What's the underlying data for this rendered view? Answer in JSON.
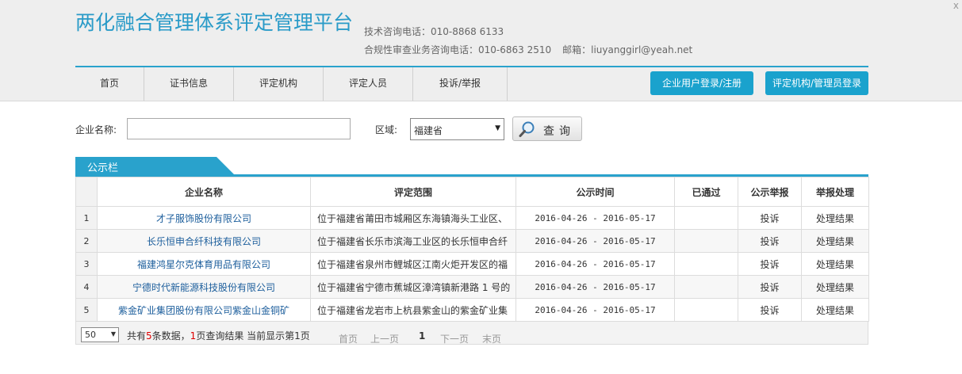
{
  "header": {
    "site_title": "两化融合管理体系评定管理平台",
    "tech_phone": "技术咨询电话：010-8868 6133",
    "compliance_phone": "合规性审查业务咨询电话：010-6863 2510",
    "email": "邮箱：liuyanggirl@yeah.net",
    "corner": "x"
  },
  "nav": {
    "items": [
      {
        "label": "首页"
      },
      {
        "label": "证书信息"
      },
      {
        "label": "评定机构"
      },
      {
        "label": "评定人员"
      },
      {
        "label": "投诉/举报"
      }
    ],
    "enterprise_login": "企业用户登录/注册",
    "admin_login": "评定机构/管理员登录"
  },
  "search": {
    "company_label": "企业名称:",
    "company_value": "",
    "region_label": "区域:",
    "region_value": "福建省",
    "query_button": "查询"
  },
  "panel": {
    "title": "公示栏"
  },
  "table": {
    "headers": [
      "企业名称",
      "评定范围",
      "公示时间",
      "已通过",
      "公示举报",
      "举报处理"
    ],
    "rows": [
      {
        "idx": "1",
        "name": "才子服饰股份有限公司",
        "scope": "位于福建省莆田市城厢区东海镇海头工业区、",
        "time": "2016-04-26 - 2016-05-17",
        "passed": "",
        "report": "投诉",
        "handle": "处理结果"
      },
      {
        "idx": "2",
        "name": "长乐恒申合纤科技有限公司",
        "scope": "位于福建省长乐市滨海工业区的长乐恒申合纤",
        "time": "2016-04-26 - 2016-05-17",
        "passed": "",
        "report": "投诉",
        "handle": "处理结果"
      },
      {
        "idx": "3",
        "name": "福建鸿星尔克体育用品有限公司",
        "scope": "位于福建省泉州市鲤城区江南火炬开发区的福",
        "time": "2016-04-26 - 2016-05-17",
        "passed": "",
        "report": "投诉",
        "handle": "处理结果"
      },
      {
        "idx": "4",
        "name": "宁德时代新能源科技股份有限公司",
        "scope": "位于福建省宁德市蕉城区漳湾镇新港路 1 号的",
        "time": "2016-04-26 - 2016-05-17",
        "passed": "",
        "report": "投诉",
        "handle": "处理结果"
      },
      {
        "idx": "5",
        "name": "紫金矿业集团股份有限公司紫金山金铜矿",
        "scope": "位于福建省龙岩市上杭县紫金山的紫金矿业集",
        "time": "2016-04-26 - 2016-05-17",
        "passed": "",
        "report": "投诉",
        "handle": "处理结果"
      }
    ]
  },
  "pager": {
    "page_size": "50",
    "text_total_prefix": "共有",
    "total_count": "5",
    "text_total_mid": "条数据，",
    "page_count": "1",
    "text_total_suffix": "页查询结果  当前显示第1页",
    "first": "首页",
    "prev": "上一页",
    "current": "1",
    "next": "下一页",
    "last": "末页"
  },
  "colors": {
    "accent": "#29a2cc",
    "link": "#1c5e9c",
    "highlight_number": "#dd0000"
  }
}
